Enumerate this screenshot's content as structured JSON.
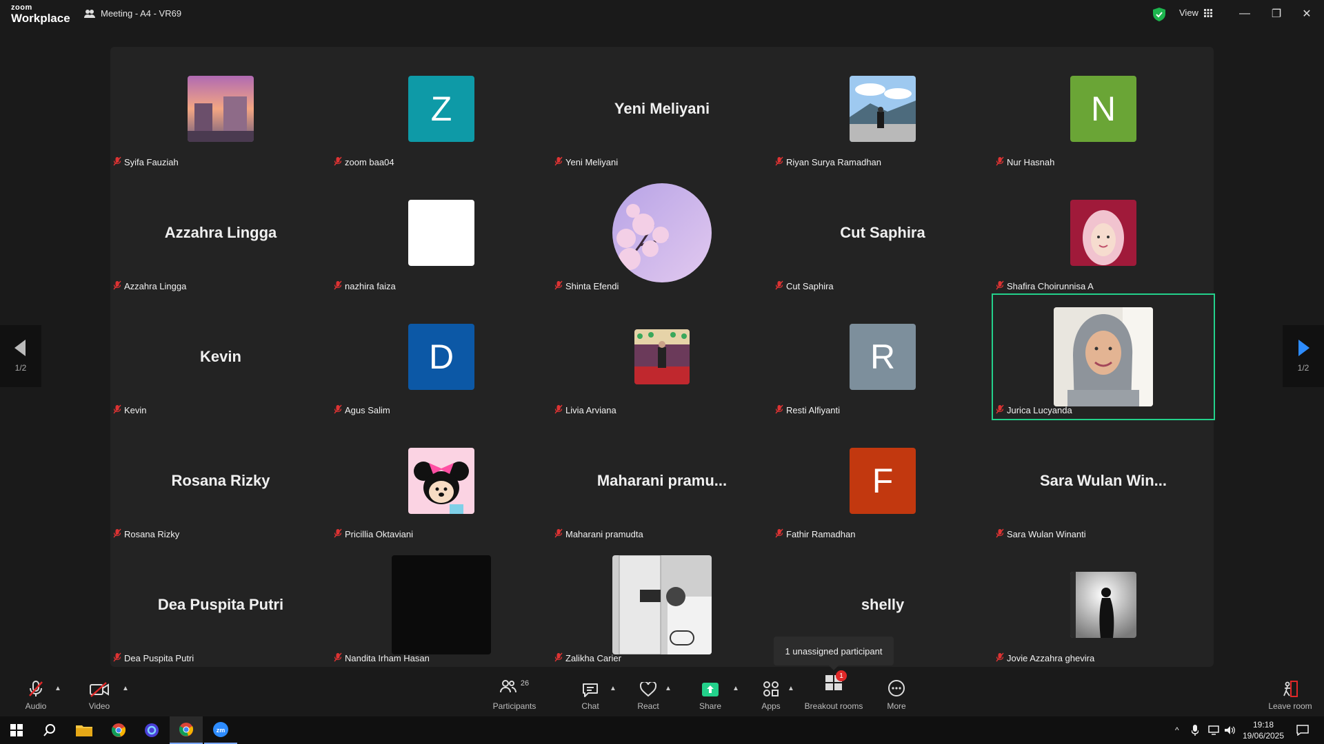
{
  "app": {
    "brand_top": "zoom",
    "brand_bottom": "Workplace",
    "meeting_title": "Meeting - A4 - VR69",
    "view_label": "View"
  },
  "pagination": {
    "left": "1/2",
    "right": "1/2"
  },
  "participants": [
    {
      "name": "Syifa Fauziah",
      "display": "photo",
      "photo": "sunset-street"
    },
    {
      "name": "zoom baa04",
      "display": "initial",
      "initial": "Z",
      "color": "#0e9aa7"
    },
    {
      "name": "Yeni Meliyani",
      "display": "name",
      "big_name": "Yeni Meliyani"
    },
    {
      "name": "Riyan Surya Ramadhan",
      "display": "photo",
      "photo": "mountain-sky"
    },
    {
      "name": "Nur Hasnah",
      "display": "initial",
      "initial": "N",
      "color": "#6aa536"
    },
    {
      "name": "Azzahra Lingga",
      "display": "name",
      "big_name": "Azzahra Lingga"
    },
    {
      "name": "nazhira faiza",
      "display": "photo",
      "photo": "white"
    },
    {
      "name": "Shinta Efendi",
      "display": "photo",
      "photo": "blossom"
    },
    {
      "name": "Cut Saphira",
      "display": "name",
      "big_name": "Cut Saphira"
    },
    {
      "name": "Shafira Choirunnisa A",
      "display": "photo",
      "photo": "pink-portrait"
    },
    {
      "name": "Kevin",
      "display": "name",
      "big_name": "Kevin"
    },
    {
      "name": "Agus Salim",
      "display": "initial",
      "initial": "D",
      "color": "#0c58a6"
    },
    {
      "name": "Livia Arviana",
      "display": "photo",
      "photo": "stage"
    },
    {
      "name": "Resti Alfiyanti",
      "display": "initial",
      "initial": "R",
      "color": "#7d8f9c"
    },
    {
      "name": "Jurica Lucyanda",
      "display": "photo",
      "photo": "hijab-portrait",
      "active": true
    },
    {
      "name": "Rosana Rizky",
      "display": "name",
      "big_name": "Rosana Rizky"
    },
    {
      "name": "Pricillia Oktaviani",
      "display": "photo",
      "photo": "minnie"
    },
    {
      "name": "Maharani pramudta",
      "display": "name",
      "big_name": "Maharani  pramu..."
    },
    {
      "name": "Fathir Ramadhan",
      "display": "initial",
      "initial": "F",
      "color": "#c2380f"
    },
    {
      "name": "Sara Wulan Winanti",
      "display": "name",
      "big_name": "Sara  Wulan  Win..."
    },
    {
      "name": "Dea Puspita Putri",
      "display": "name",
      "big_name": "Dea Puspita Putri"
    },
    {
      "name": "Nandita Irham Hasan",
      "display": "photo",
      "photo": "black"
    },
    {
      "name": "Zalikha Carier",
      "display": "photo",
      "photo": "mirror-selfie"
    },
    {
      "name": "shelly",
      "display": "name",
      "big_name": "shelly"
    },
    {
      "name": "Jovie Azzahra ghevira",
      "display": "photo",
      "photo": "silhouette"
    }
  ],
  "tooltip": "1 unassigned participant",
  "toolbar": {
    "audio": "Audio",
    "video": "Video",
    "participants": "Participants",
    "participants_count": "26",
    "chat": "Chat",
    "react": "React",
    "share": "Share",
    "apps": "Apps",
    "breakout": "Breakout rooms",
    "breakout_badge": "1",
    "more": "More",
    "leave": "Leave room"
  },
  "taskbar": {
    "time": "19:18",
    "date": "19/06/2025"
  },
  "colors": {
    "active_border": "#23d18b",
    "share_green": "#23d18b",
    "badge_red": "#e02828"
  }
}
